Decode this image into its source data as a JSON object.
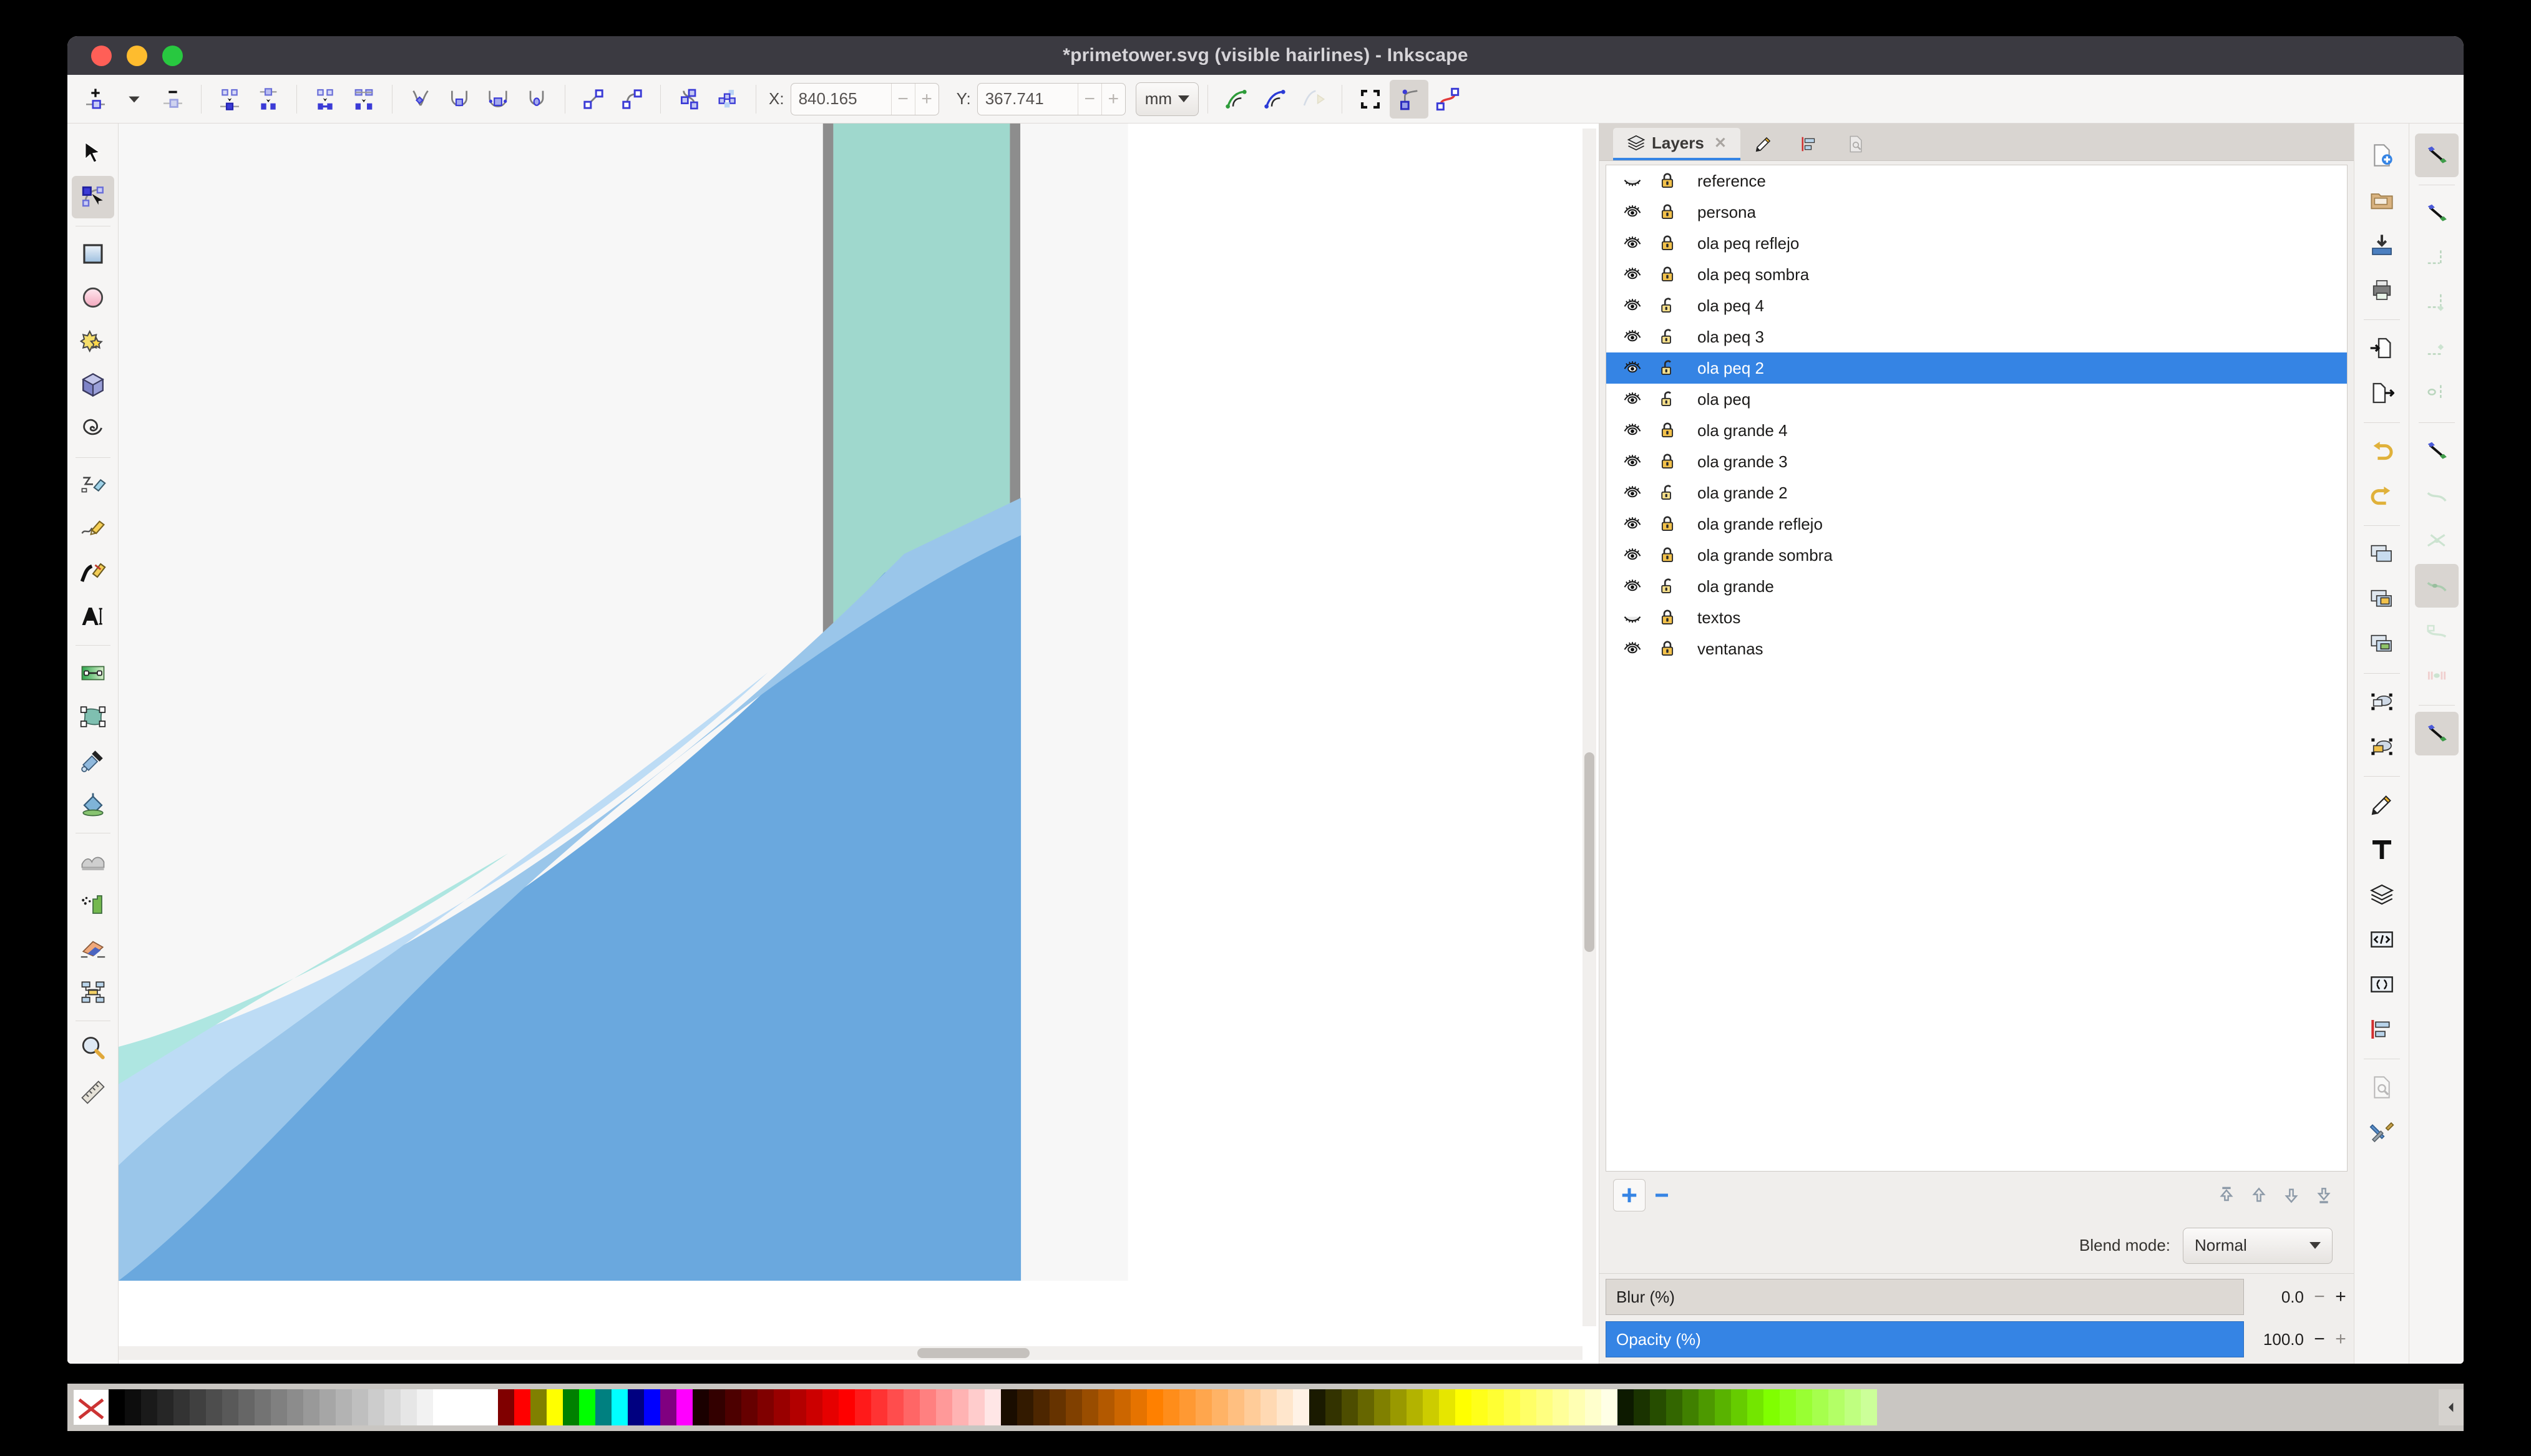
{
  "window": {
    "title": "*primetower.svg (visible hairlines) - Inkscape",
    "controls": {
      "close": "close",
      "minimize": "minimize",
      "maximize": "maximize"
    }
  },
  "toolbar": {
    "node_tools": [
      {
        "name": "insert-node-button",
        "label": "Insert node"
      },
      {
        "name": "insert-node-dropdown",
        "label": "Insert node options"
      },
      {
        "name": "delete-node-button",
        "label": "Delete node"
      },
      {
        "name": "break-path-button",
        "label": "Break path at nodes"
      },
      {
        "name": "join-nodes-button",
        "label": "Join selected nodes"
      },
      {
        "name": "join-with-segment-button",
        "label": "Join with segment"
      },
      {
        "name": "delete-segment-button",
        "label": "Delete segment"
      },
      {
        "name": "node-cusp-button",
        "label": "Make corner"
      },
      {
        "name": "node-smooth-button",
        "label": "Make smooth"
      },
      {
        "name": "node-symmetric-button",
        "label": "Make symmetric"
      },
      {
        "name": "node-auto-button",
        "label": "Make auto-smooth"
      },
      {
        "name": "segment-line-button",
        "label": "Make line"
      },
      {
        "name": "segment-curve-button",
        "label": "Make curve"
      },
      {
        "name": "object-to-path-button",
        "label": "Object to path"
      },
      {
        "name": "stroke-to-path-button",
        "label": "Stroke to path"
      }
    ],
    "x_label": "X:",
    "x_value": "840.165",
    "y_label": "Y:",
    "y_value": "367.741",
    "unit": "mm",
    "right_tools": [
      {
        "name": "show-transform-handles-button",
        "label": "Show transform handles"
      },
      {
        "name": "show-bezier-handles-button",
        "label": "Show Bezier handles"
      },
      {
        "name": "show-path-outline-button",
        "label": "Show path outline"
      },
      {
        "name": "show-clip-paths-button",
        "label": "Show clipping paths"
      },
      {
        "name": "show-mask-paths-button",
        "label": "Show mask paths"
      },
      {
        "name": "next-path-effect-button",
        "label": "Next path effect parameter"
      }
    ]
  },
  "toolbox": {
    "tools": [
      {
        "name": "selector-tool",
        "label": "Selector",
        "active": false
      },
      {
        "name": "node-tool",
        "label": "Node editor",
        "active": true
      },
      {
        "name": "rectangle-tool",
        "label": "Rectangle",
        "active": false
      },
      {
        "name": "ellipse-tool",
        "label": "Ellipse / Arc",
        "active": false
      },
      {
        "name": "star-tool",
        "label": "Star / Polygon",
        "active": false
      },
      {
        "name": "box3d-tool",
        "label": "3D Box",
        "active": false
      },
      {
        "name": "spiral-tool",
        "label": "Spiral",
        "active": false
      },
      {
        "name": "pencil-tool",
        "label": "Pencil (Freehand)",
        "active": false
      },
      {
        "name": "calligraphy-tool",
        "label": "Calligraphy",
        "active": false
      },
      {
        "name": "pen-tool",
        "label": "Bezier / Pen",
        "active": false
      },
      {
        "name": "text-tool",
        "label": "Text",
        "active": false
      },
      {
        "name": "gradient-tool",
        "label": "Gradient",
        "active": false
      },
      {
        "name": "mesh-gradient-tool",
        "label": "Mesh gradient",
        "active": false
      },
      {
        "name": "dropper-tool",
        "label": "Color picker",
        "active": false
      },
      {
        "name": "paint-bucket-tool",
        "label": "Paint bucket",
        "active": false
      },
      {
        "name": "tweak-tool",
        "label": "Tweak objects",
        "active": false
      },
      {
        "name": "spray-tool",
        "label": "Spray objects",
        "active": false
      },
      {
        "name": "eraser-tool",
        "label": "Eraser",
        "active": false
      },
      {
        "name": "connector-tool",
        "label": "Connector",
        "active": false
      },
      {
        "name": "zoom-tool",
        "label": "Zoom",
        "active": false
      },
      {
        "name": "measure-tool",
        "label": "Measure",
        "active": false
      }
    ]
  },
  "panel": {
    "tabs": [
      {
        "name": "tab-layers",
        "label": "Layers",
        "icon": "layers-icon",
        "active": true,
        "closable": true
      },
      {
        "name": "tab-fill-stroke",
        "label": "",
        "icon": "fill-stroke-icon",
        "active": false,
        "closable": false
      },
      {
        "name": "tab-align-distribute",
        "label": "",
        "icon": "align-icon",
        "active": false,
        "closable": false
      },
      {
        "name": "tab-document-properties",
        "label": "",
        "icon": "document-properties-icon",
        "active": false,
        "closable": false
      }
    ],
    "layers": [
      {
        "name": "reference",
        "visible": false,
        "locked": true,
        "selected": false
      },
      {
        "name": "persona",
        "visible": true,
        "locked": true,
        "selected": false
      },
      {
        "name": "ola peq reflejo",
        "visible": true,
        "locked": true,
        "selected": false
      },
      {
        "name": "ola peq sombra",
        "visible": true,
        "locked": true,
        "selected": false
      },
      {
        "name": "ola peq 4",
        "visible": true,
        "locked": false,
        "selected": false
      },
      {
        "name": "ola peq 3",
        "visible": true,
        "locked": false,
        "selected": false
      },
      {
        "name": "ola peq 2",
        "visible": true,
        "locked": false,
        "selected": true
      },
      {
        "name": "ola peq",
        "visible": true,
        "locked": false,
        "selected": false
      },
      {
        "name": "ola grande 4",
        "visible": true,
        "locked": true,
        "selected": false
      },
      {
        "name": "ola grande 3",
        "visible": true,
        "locked": true,
        "selected": false
      },
      {
        "name": "ola grande 2",
        "visible": true,
        "locked": false,
        "selected": false
      },
      {
        "name": "ola grande reflejo",
        "visible": true,
        "locked": true,
        "selected": false
      },
      {
        "name": "ola grande sombra",
        "visible": true,
        "locked": true,
        "selected": false
      },
      {
        "name": "ola grande",
        "visible": true,
        "locked": false,
        "selected": false
      },
      {
        "name": "textos",
        "visible": false,
        "locked": true,
        "selected": false
      },
      {
        "name": "ventanas",
        "visible": true,
        "locked": true,
        "selected": false
      }
    ],
    "buttons": {
      "add_layer": "+",
      "remove_layer": "-",
      "raise_to_top": "Raise layer to top",
      "raise_one": "Raise layer",
      "lower_one": "Lower layer",
      "lower_to_bottom": "Lower layer to bottom"
    },
    "blend_mode_label": "Blend mode:",
    "blend_mode_value": "Normal",
    "blur": {
      "label": "Blur (%)",
      "value": "0.0",
      "fill_percent": 0
    },
    "opacity": {
      "label": "Opacity (%)",
      "value": "100.0",
      "fill_percent": 100
    }
  },
  "rail_commands": [
    {
      "name": "new-document-button",
      "label": "New"
    },
    {
      "name": "open-document-button",
      "label": "Open"
    },
    {
      "name": "save-document-button",
      "label": "Save"
    },
    {
      "name": "print-document-button",
      "label": "Print"
    },
    {
      "name": "import-button",
      "label": "Import"
    },
    {
      "name": "export-button",
      "label": "Export"
    },
    {
      "name": "undo-button",
      "label": "Undo"
    },
    {
      "name": "redo-button",
      "label": "Redo"
    },
    {
      "name": "duplicate-button",
      "label": "Duplicate"
    },
    {
      "name": "clone-button",
      "label": "Clone"
    },
    {
      "name": "unlink-clone-button",
      "label": "Unlink clone"
    },
    {
      "name": "group-button",
      "label": "Group"
    },
    {
      "name": "ungroup-button",
      "label": "Ungroup"
    },
    {
      "name": "fill-stroke-dialog-button",
      "label": "Fill and Stroke"
    },
    {
      "name": "text-dialog-button",
      "label": "Text and Font"
    },
    {
      "name": "layers-dialog-button",
      "label": "Layers"
    },
    {
      "name": "xml-editor-button",
      "label": "XML Editor"
    },
    {
      "name": "selectors-dialog-button",
      "label": "Selectors and CSS"
    },
    {
      "name": "align-dialog-button",
      "label": "Align and Distribute"
    },
    {
      "name": "document-properties-button",
      "label": "Document Properties"
    },
    {
      "name": "preferences-button",
      "label": "Preferences"
    }
  ],
  "rail_snap": [
    {
      "name": "enable-snapping-button",
      "label": "Enable snapping",
      "active": true
    },
    {
      "name": "snap-bounding-box-button",
      "label": "Snap bounding boxes",
      "active": false
    },
    {
      "name": "snap-bbox-edge-button",
      "label": "Snap bounding box edges",
      "active": false
    },
    {
      "name": "snap-bbox-corner-button",
      "label": "Snap bounding box corners",
      "active": false
    },
    {
      "name": "snap-bbox-midpoint-button",
      "label": "Snap bounding box edge midpoints",
      "active": false
    },
    {
      "name": "snap-bbox-center-button",
      "label": "Snap bounding box centers",
      "active": false
    },
    {
      "name": "snap-nodes-button",
      "label": "Snap nodes, paths and handles",
      "active": false
    },
    {
      "name": "snap-path-button",
      "label": "Snap to paths",
      "active": false
    },
    {
      "name": "snap-path-intersection-button",
      "label": "Snap to path intersections",
      "active": false
    },
    {
      "name": "snap-cusp-node-button",
      "label": "Snap to cusp nodes",
      "active": true
    },
    {
      "name": "snap-smooth-node-button",
      "label": "Snap to smooth nodes",
      "active": false
    },
    {
      "name": "snap-midpoint-button",
      "label": "Snap midpoints of line segments",
      "active": false
    },
    {
      "name": "snap-others-button",
      "label": "Snap other points",
      "active": true
    }
  ],
  "palette": {
    "none_swatch_label": "None",
    "scroll_arrow_label": "Scroll palette",
    "swatches": [
      "#000000",
      "#0d0d0d",
      "#1a1a1a",
      "#262626",
      "#333333",
      "#404040",
      "#4d4d4d",
      "#595959",
      "#666666",
      "#737373",
      "#808080",
      "#8c8c8c",
      "#999999",
      "#a6a6a6",
      "#b3b3b3",
      "#bfbfbf",
      "#cccccc",
      "#d9d9d9",
      "#e6e6e6",
      "#f2f2f2",
      "#ffffff",
      "#ffffff",
      "#ffffff",
      "#ffffff",
      "#800000",
      "#ff0000",
      "#808000",
      "#ffff00",
      "#008000",
      "#00ff00",
      "#008080",
      "#00ffff",
      "#000080",
      "#0000ff",
      "#800080",
      "#ff00ff",
      "#1a0000",
      "#330000",
      "#4d0000",
      "#660000",
      "#800000",
      "#990000",
      "#b30000",
      "#cc0000",
      "#e60000",
      "#ff0000",
      "#ff1a1a",
      "#ff3333",
      "#ff4d4d",
      "#ff6666",
      "#ff8080",
      "#ff9999",
      "#ffb3b3",
      "#ffcccc",
      "#ffe6e6",
      "#1a0d00",
      "#331a00",
      "#4d2600",
      "#663300",
      "#804000",
      "#994d00",
      "#b35900",
      "#cc6600",
      "#e67300",
      "#ff8000",
      "#ff8d1a",
      "#ff9933",
      "#ffa64d",
      "#ffb366",
      "#ffbf80",
      "#ffcc99",
      "#ffd9b3",
      "#ffe6cc",
      "#fff2e6",
      "#1a1a00",
      "#333300",
      "#4d4d00",
      "#666600",
      "#808000",
      "#999900",
      "#b3b300",
      "#cccc00",
      "#e6e600",
      "#ffff00",
      "#ffff1a",
      "#ffff33",
      "#ffff4d",
      "#ffff66",
      "#ffff80",
      "#ffff99",
      "#ffffb3",
      "#ffffcc",
      "#ffffe6",
      "#0d1a00",
      "#1a3300",
      "#264d00",
      "#336600",
      "#408000",
      "#4d9900",
      "#59b300",
      "#66cc00",
      "#73e600",
      "#80ff00",
      "#8dff1a",
      "#99ff33",
      "#a6ff4d",
      "#b3ff66",
      "#bfff80",
      "#ccff99"
    ]
  },
  "canvas": {
    "artwork_title": "primetower wave illustration",
    "colors": {
      "page_background": "#f7f7f7",
      "tower_glass": "#9fd8cd",
      "tower_frame": "#8d8d8d",
      "wave_dark_blue": "#6aa8de",
      "wave_mid_blue": "#7fb5e3",
      "wave_light_blue": "#a8cdee",
      "wave_pale_blue": "#bddcf5",
      "wave_mint": "#aee6e1"
    }
  }
}
